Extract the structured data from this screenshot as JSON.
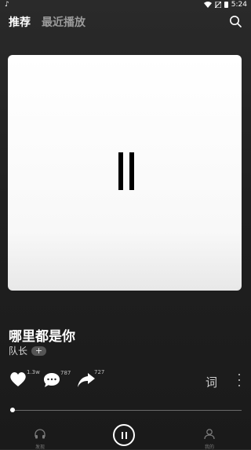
{
  "status_bar": {
    "time": "5:24"
  },
  "top_nav": {
    "tabs": [
      "推荐",
      "最近播放"
    ]
  },
  "song": {
    "title": "哪里都是你",
    "artist": "队长",
    "follow_label": "+"
  },
  "actions": {
    "like_count": "1.3w",
    "comment_count": "787",
    "share_count": "727",
    "lyrics_label": "词"
  },
  "playback": {
    "progress": 0.01,
    "state": "paused"
  },
  "bottom_nav": {
    "items": [
      "发现",
      "我的"
    ]
  },
  "colors": {
    "background": "#1e1e1e",
    "accent": "#ffffff",
    "muted": "#9a9a9a"
  }
}
